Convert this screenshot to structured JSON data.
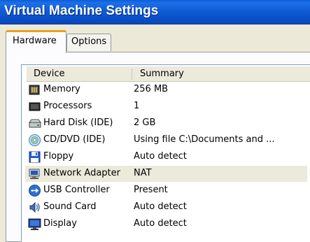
{
  "window": {
    "title": "Virtual Machine Settings"
  },
  "tabs": [
    {
      "label": "Hardware",
      "active": true
    },
    {
      "label": "Options",
      "active": false
    }
  ],
  "table": {
    "columns": [
      "Device",
      "Summary"
    ],
    "rows": [
      {
        "device": "Memory",
        "summary": "256 MB",
        "icon": "memory-chip-icon"
      },
      {
        "device": "Processors",
        "summary": "1",
        "icon": "processor-chip-icon"
      },
      {
        "device": "Hard Disk (IDE)",
        "summary": "2 GB",
        "icon": "hard-disk-icon"
      },
      {
        "device": "CD/DVD (IDE)",
        "summary": "Using file C:\\Documents and ...",
        "icon": "cd-dvd-icon"
      },
      {
        "device": "Floppy",
        "summary": "Auto detect",
        "icon": "floppy-disk-icon"
      },
      {
        "device": "Network Adapter",
        "summary": "NAT",
        "icon": "network-adapter-icon",
        "selected": true
      },
      {
        "device": "USB Controller",
        "summary": "Present",
        "icon": "usb-icon"
      },
      {
        "device": "Sound Card",
        "summary": "Auto detect",
        "icon": "sound-card-icon"
      },
      {
        "device": "Display",
        "summary": "Auto detect",
        "icon": "display-monitor-icon"
      }
    ]
  },
  "colors": {
    "titlebar": "#0a4cc4",
    "active_tab_highlight": "#e6a21a",
    "selection": "#ebeadb"
  }
}
